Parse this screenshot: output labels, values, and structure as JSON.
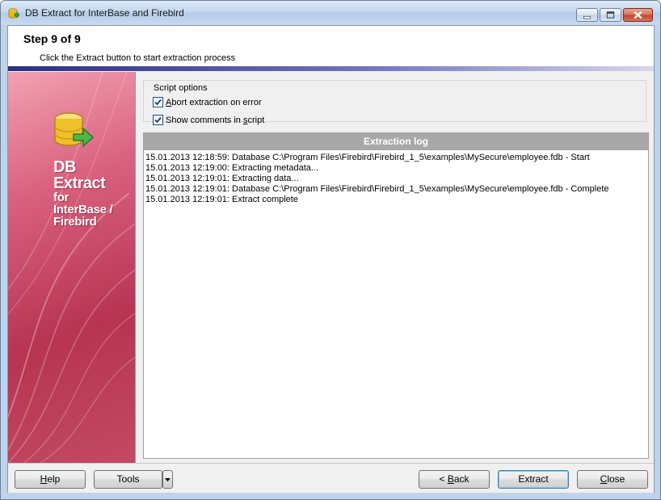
{
  "window": {
    "title": "DB Extract for InterBase and Firebird",
    "icon": "database-app-icon"
  },
  "header": {
    "step": "Step 9 of 9",
    "description": "Click the Extract button to start extraction process"
  },
  "sidebar": {
    "product_line1": "DB",
    "product_line2": "Extract",
    "product_line3": "for",
    "product_line4": "InterBase /",
    "product_line5": "Firebird",
    "icon": "database-export-icon"
  },
  "script_options": {
    "title": "Script options",
    "abort_on_error": {
      "label_pre": "",
      "label_key": "A",
      "label_post": "bort extraction on error",
      "checked": true
    },
    "show_comments": {
      "label_pre": "Show comments in ",
      "label_key": "s",
      "label_post": "cript",
      "checked": true
    }
  },
  "log": {
    "title": "Extraction log",
    "lines": [
      "15.01.2013 12:18:59: Database C:\\Program Files\\Firebird\\Firebird_1_5\\examples\\MySecure\\employee.fdb - Start",
      "15.01.2013 12:19:00: Extracting metadata...",
      "15.01.2013 12:19:01: Extracting data...",
      "15.01.2013 12:19:01: Database C:\\Program Files\\Firebird\\Firebird_1_5\\examples\\MySecure\\employee.fdb - Complete",
      "15.01.2013 12:19:01: Extract complete"
    ]
  },
  "footer": {
    "help": {
      "key": "H",
      "rest": "elp"
    },
    "tools": "Tools",
    "back": {
      "pre": "< ",
      "key": "B",
      "rest": "ack"
    },
    "extract": "Extract",
    "close": {
      "key": "C",
      "rest": "lose"
    }
  },
  "colors": {
    "header_bar": "#2b2e82",
    "sidebar": "#b73453",
    "log_header": "#a8a8a8"
  }
}
